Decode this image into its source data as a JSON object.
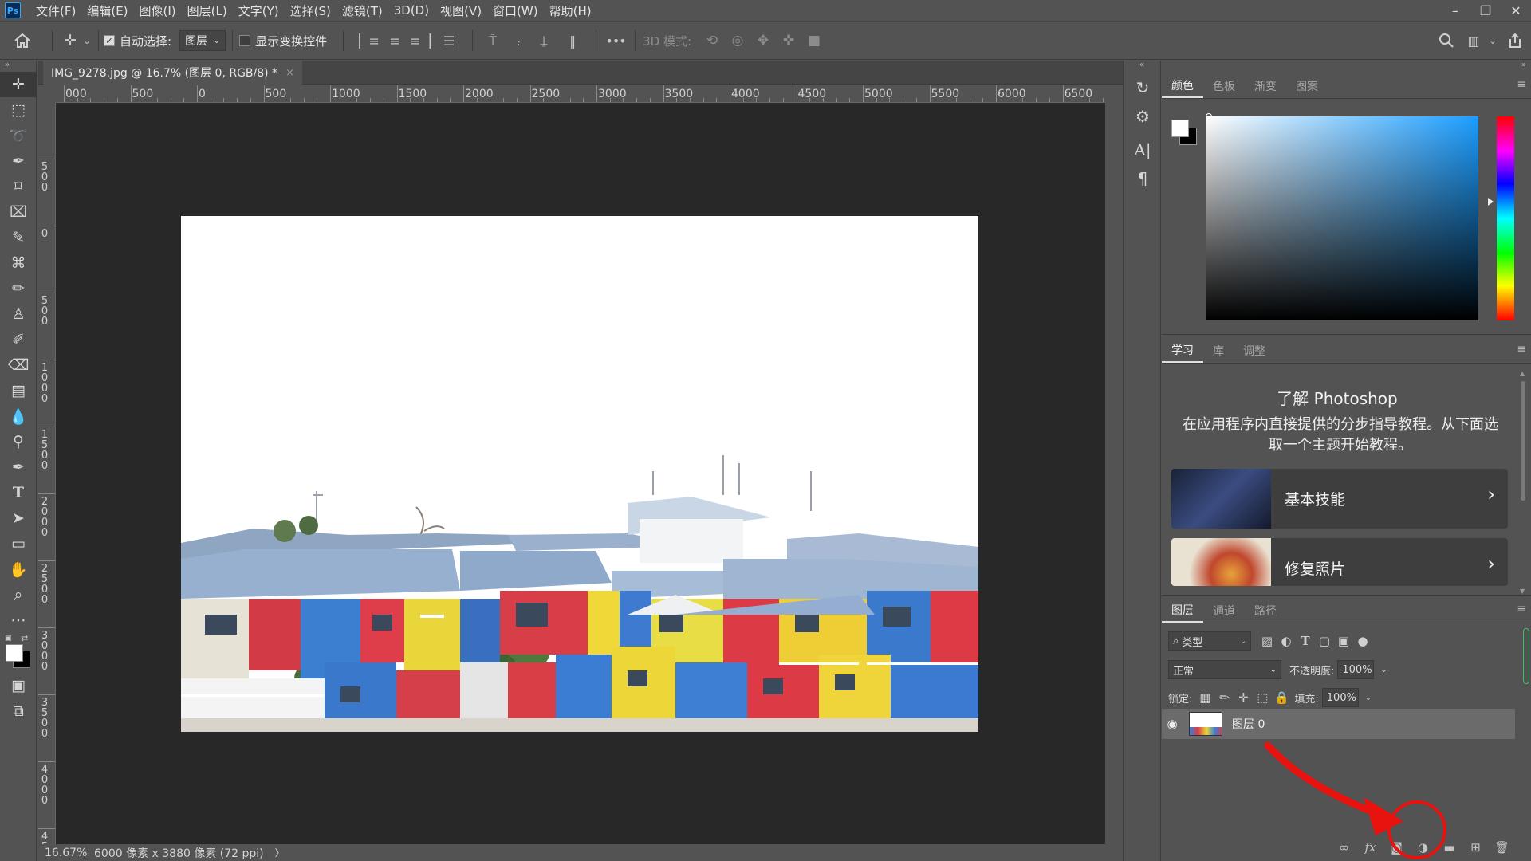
{
  "menubar": {
    "logo": "Ps",
    "items": [
      "文件(F)",
      "编辑(E)",
      "图像(I)",
      "图层(L)",
      "文字(Y)",
      "选择(S)",
      "滤镜(T)",
      "3D(D)",
      "视图(V)",
      "窗口(W)",
      "帮助(H)"
    ],
    "window_controls": [
      "minimize-icon",
      "restore-icon",
      "close-icon"
    ]
  },
  "options": {
    "auto_select_label": "自动选择:",
    "auto_select_value": "图层",
    "show_transform_label": "显示变换控件",
    "more": "•••",
    "mode_3d_label": "3D 模式:"
  },
  "document": {
    "tab_title": "IMG_9278.jpg @ 16.7% (图层 0, RGB/8) *",
    "close": "×",
    "ruler_top": [
      "000",
      "500",
      "0",
      "500",
      "1000",
      "1500",
      "2000",
      "2500",
      "3000",
      "3500",
      "4000",
      "4500",
      "5000",
      "5500",
      "6000",
      "6500"
    ],
    "ruler_left": [
      "0",
      "5 0 0",
      "0",
      "5 0 0",
      "1 0 0 0",
      "1 5 0 0",
      "2 0 0 0",
      "2 5 0 0",
      "3 0 0 0",
      "3 5 0 0",
      "4 0 0 0",
      "4 5"
    ]
  },
  "status": {
    "zoom": "16.67%",
    "info": "6000 像素 x 3880 像素 (72 ppi)",
    "arrow": "〉"
  },
  "color_panel": {
    "tabs": [
      "颜色",
      "色板",
      "渐变",
      "图案"
    ],
    "active": 0,
    "foreground": "#ffffff",
    "background": "#000000",
    "hue": "#1b9dff"
  },
  "learn_panel": {
    "tabs": [
      "学习",
      "库",
      "调整"
    ],
    "title": "了解 Photoshop",
    "description": "在应用程序内直接提供的分步指导教程。从下面选取一个主题开始教程。",
    "cards": [
      {
        "label": "基本技能"
      },
      {
        "label": "修复照片"
      }
    ]
  },
  "layers_panel": {
    "tabs": [
      "图层",
      "通道",
      "路径"
    ],
    "filter_label": "类型",
    "blend_mode": "正常",
    "opacity_label": "不透明度:",
    "opacity_value": "100%",
    "lock_label": "锁定:",
    "fill_label": "填充:",
    "fill_value": "100%",
    "layers": [
      {
        "name": "图层 0",
        "visible": true
      }
    ],
    "footer_icons": [
      "link-icon",
      "fx-icon",
      "mask-icon",
      "adjustment-layer-icon",
      "group-icon",
      "new-layer-icon",
      "trash-icon"
    ],
    "fx_label": "fx"
  },
  "colors": {
    "annotation": "#e8120e",
    "accent": "#31a8ff"
  }
}
